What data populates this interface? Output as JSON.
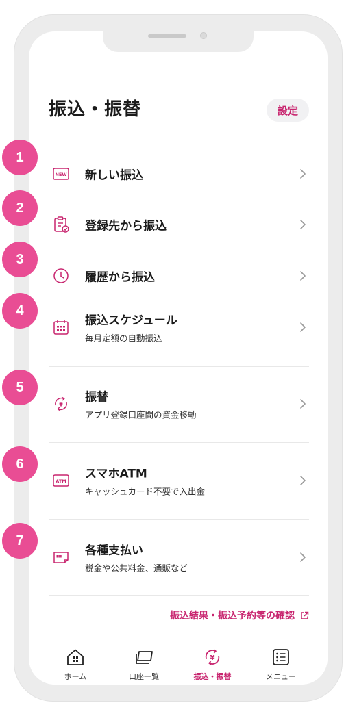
{
  "page": {
    "title": "振込・振替",
    "settings_label": "設定"
  },
  "menu": [
    {
      "title": "新しい振込",
      "subtitle": "",
      "icon": "new-badge-icon"
    },
    {
      "title": "登録先から振込",
      "subtitle": "",
      "icon": "clipboard-check-icon"
    },
    {
      "title": "履歴から振込",
      "subtitle": "",
      "icon": "clock-icon"
    },
    {
      "title": "振込スケジュール",
      "subtitle": "毎月定額の自動振込",
      "icon": "calendar-icon"
    },
    {
      "title": "振替",
      "subtitle": "アプリ登録口座間の資金移動",
      "icon": "yen-transfer-icon"
    },
    {
      "title": "スマホATM",
      "subtitle": "キャッシュカード不要で入出金",
      "icon": "atm-icon"
    },
    {
      "title": "各種支払い",
      "subtitle": "税金や公共料金、通販など",
      "icon": "bill-icon"
    }
  ],
  "icon_text": {
    "new": "NEW",
    "atm": "ATM",
    "yen": "¥"
  },
  "footer_link": {
    "label": "振込結果・振込予約等の確認",
    "icon": "external-link-icon"
  },
  "tabs": [
    {
      "label": "ホーム",
      "icon": "home-icon",
      "active": false
    },
    {
      "label": "口座一覧",
      "icon": "passbook-icon",
      "active": false
    },
    {
      "label": "振込・振替",
      "icon": "yen-transfer-icon",
      "active": true
    },
    {
      "label": "メニュー",
      "icon": "list-menu-icon",
      "active": false
    }
  ],
  "badges": [
    "1",
    "2",
    "3",
    "4",
    "5",
    "6",
    "7"
  ],
  "colors": {
    "accent": "#c8256f",
    "badge": "#e94d94",
    "text": "#1b1b1b"
  }
}
